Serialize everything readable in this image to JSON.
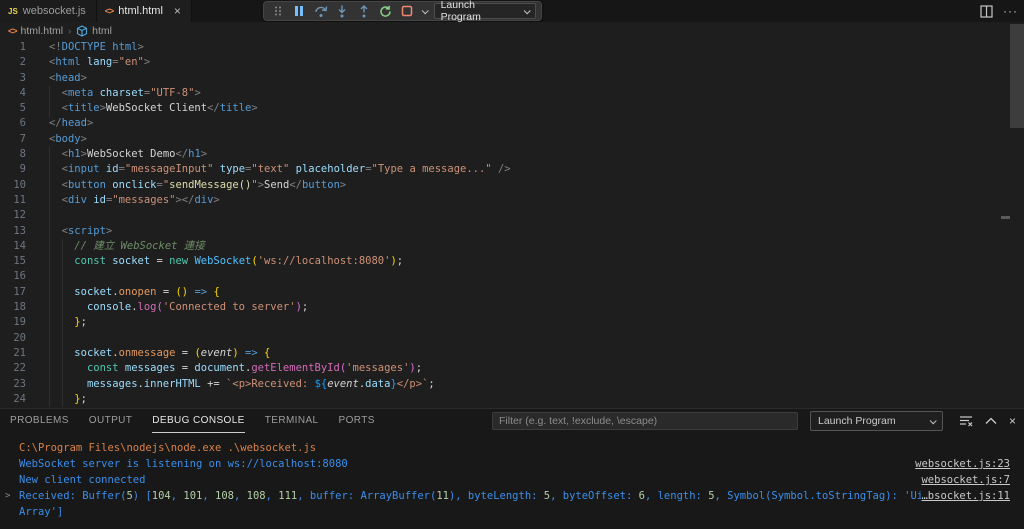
{
  "editor_tabs": [
    {
      "label": "websocket.js",
      "icon": "js-file-icon",
      "active": false
    },
    {
      "label": "html.html",
      "icon": "html-file-icon",
      "active": true,
      "close_glyph": "×"
    }
  ],
  "debug_toolbar": {
    "launch_label": "Launch Program",
    "icons": [
      "drag-grip",
      "pause",
      "step-over",
      "step-into",
      "step-out",
      "restart",
      "stop",
      "stop-dropdown-chevron"
    ]
  },
  "editor_actions": {
    "split_icon": "split-editor",
    "more_icon": "more-actions",
    "more_glyph": "···"
  },
  "breadcrumb": {
    "file": "html.html",
    "separator": "›",
    "symbol": "html"
  },
  "editor": {
    "lines": [
      {
        "n": 1,
        "s": [
          [
            "g",
            "<!"
          ],
          [
            "t",
            "DOCTYPE"
          ],
          [
            "w",
            " "
          ],
          [
            "t",
            "html"
          ],
          [
            "g",
            ">"
          ]
        ]
      },
      {
        "n": 2,
        "s": [
          [
            "g",
            "<"
          ],
          [
            "t",
            "html"
          ],
          [
            "w",
            " "
          ],
          [
            "a",
            "lang"
          ],
          [
            "g",
            "="
          ],
          [
            "s",
            "\"en\""
          ],
          [
            "g",
            ">"
          ]
        ]
      },
      {
        "n": 3,
        "s": [
          [
            "g",
            "<"
          ],
          [
            "t",
            "head"
          ],
          [
            "g",
            ">"
          ]
        ]
      },
      {
        "n": 4,
        "s": [
          [
            "w",
            "  "
          ],
          [
            "g",
            "<"
          ],
          [
            "t",
            "meta"
          ],
          [
            "w",
            " "
          ],
          [
            "a",
            "charset"
          ],
          [
            "g",
            "="
          ],
          [
            "s",
            "\"UTF-8\""
          ],
          [
            "g",
            ">"
          ]
        ]
      },
      {
        "n": 5,
        "s": [
          [
            "w",
            "  "
          ],
          [
            "g",
            "<"
          ],
          [
            "t",
            "title"
          ],
          [
            "g",
            ">"
          ],
          [
            "w",
            "WebSocket Client"
          ],
          [
            "g",
            "</"
          ],
          [
            "t",
            "title"
          ],
          [
            "g",
            ">"
          ]
        ]
      },
      {
        "n": 6,
        "s": [
          [
            "g",
            "</"
          ],
          [
            "t",
            "head"
          ],
          [
            "g",
            ">"
          ]
        ]
      },
      {
        "n": 7,
        "s": [
          [
            "g",
            "<"
          ],
          [
            "t",
            "body"
          ],
          [
            "g",
            ">"
          ]
        ]
      },
      {
        "n": 8,
        "s": [
          [
            "w",
            "  "
          ],
          [
            "g",
            "<"
          ],
          [
            "t",
            "h1"
          ],
          [
            "g",
            ">"
          ],
          [
            "w",
            "WebSocket Demo"
          ],
          [
            "g",
            "</"
          ],
          [
            "t",
            "h1"
          ],
          [
            "g",
            ">"
          ]
        ]
      },
      {
        "n": 9,
        "s": [
          [
            "w",
            "  "
          ],
          [
            "g",
            "<"
          ],
          [
            "t",
            "input"
          ],
          [
            "w",
            " "
          ],
          [
            "a",
            "id"
          ],
          [
            "g",
            "="
          ],
          [
            "s",
            "\"messageInput\""
          ],
          [
            "w",
            " "
          ],
          [
            "a",
            "type"
          ],
          [
            "g",
            "="
          ],
          [
            "s",
            "\"text\""
          ],
          [
            "w",
            " "
          ],
          [
            "a",
            "placeholder"
          ],
          [
            "g",
            "="
          ],
          [
            "s",
            "\"Type a message...\""
          ],
          [
            "w",
            " "
          ],
          [
            "g",
            "/>"
          ]
        ]
      },
      {
        "n": 10,
        "s": [
          [
            "w",
            "  "
          ],
          [
            "g",
            "<"
          ],
          [
            "t",
            "button"
          ],
          [
            "w",
            " "
          ],
          [
            "a",
            "onclick"
          ],
          [
            "g",
            "="
          ],
          [
            "s",
            "\""
          ],
          [
            "fy",
            "sendMessage()"
          ],
          [
            "s",
            "\""
          ],
          [
            "g",
            ">"
          ],
          [
            "w",
            "Send"
          ],
          [
            "g",
            "</"
          ],
          [
            "t",
            "button"
          ],
          [
            "g",
            ">"
          ]
        ]
      },
      {
        "n": 11,
        "s": [
          [
            "w",
            "  "
          ],
          [
            "g",
            "<"
          ],
          [
            "t",
            "div"
          ],
          [
            "w",
            " "
          ],
          [
            "a",
            "id"
          ],
          [
            "g",
            "="
          ],
          [
            "s",
            "\"messages\""
          ],
          [
            "g",
            "></"
          ],
          [
            "t",
            "div"
          ],
          [
            "g",
            ">"
          ]
        ]
      },
      {
        "n": 12,
        "s": []
      },
      {
        "n": 13,
        "s": [
          [
            "w",
            "  "
          ],
          [
            "g",
            "<"
          ],
          [
            "t",
            "script"
          ],
          [
            "g",
            ">"
          ]
        ]
      },
      {
        "n": 14,
        "s": [
          [
            "c",
            "    // 建立 WebSocket 連接"
          ]
        ]
      },
      {
        "n": 15,
        "s": [
          [
            "w",
            "    "
          ],
          [
            "k",
            "const"
          ],
          [
            "w",
            " "
          ],
          [
            "v",
            "socket"
          ],
          [
            "w",
            " = "
          ],
          [
            "k",
            "new"
          ],
          [
            "w",
            " "
          ],
          [
            "cl",
            "WebSocket"
          ],
          [
            "b1",
            "("
          ],
          [
            "s",
            "'ws://localhost:8080'"
          ],
          [
            "b1",
            ")"
          ],
          [
            "w",
            ";"
          ]
        ]
      },
      {
        "n": 16,
        "s": []
      },
      {
        "n": 17,
        "s": [
          [
            "w",
            "    "
          ],
          [
            "v",
            "socket"
          ],
          [
            "w",
            "."
          ],
          [
            "o",
            "onopen"
          ],
          [
            "w",
            " = "
          ],
          [
            "b1",
            "()"
          ],
          [
            "w",
            " "
          ],
          [
            "ar",
            "=>"
          ],
          [
            "w",
            " "
          ],
          [
            "b1",
            "{"
          ]
        ]
      },
      {
        "n": 18,
        "s": [
          [
            "w",
            "      "
          ],
          [
            "v",
            "console"
          ],
          [
            "w",
            "."
          ],
          [
            "fm",
            "log"
          ],
          [
            "b2",
            "("
          ],
          [
            "s",
            "'Connected to server'"
          ],
          [
            "b2",
            ")"
          ],
          [
            "w",
            ";"
          ]
        ]
      },
      {
        "n": 19,
        "s": [
          [
            "w",
            "    "
          ],
          [
            "b1",
            "}"
          ],
          [
            "w",
            ";"
          ]
        ]
      },
      {
        "n": 20,
        "s": []
      },
      {
        "n": 21,
        "s": [
          [
            "w",
            "    "
          ],
          [
            "v",
            "socket"
          ],
          [
            "w",
            "."
          ],
          [
            "o",
            "onmessage"
          ],
          [
            "w",
            " = "
          ],
          [
            "b1",
            "("
          ],
          [
            "it",
            "event"
          ],
          [
            "b1",
            ")"
          ],
          [
            "w",
            " "
          ],
          [
            "ar",
            "=>"
          ],
          [
            "w",
            " "
          ],
          [
            "b1",
            "{"
          ]
        ]
      },
      {
        "n": 22,
        "s": [
          [
            "w",
            "      "
          ],
          [
            "k",
            "const"
          ],
          [
            "w",
            " "
          ],
          [
            "v",
            "messages"
          ],
          [
            "w",
            " = "
          ],
          [
            "v",
            "document"
          ],
          [
            "w",
            "."
          ],
          [
            "fm",
            "getElementById"
          ],
          [
            "b2",
            "("
          ],
          [
            "s",
            "'messages'"
          ],
          [
            "b2",
            ")"
          ],
          [
            "w",
            ";"
          ]
        ]
      },
      {
        "n": 23,
        "s": [
          [
            "w",
            "      "
          ],
          [
            "v",
            "messages"
          ],
          [
            "w",
            "."
          ],
          [
            "v",
            "innerHTML"
          ],
          [
            "w",
            " += "
          ],
          [
            "s",
            "`<p>Received: "
          ],
          [
            "b3",
            "${"
          ],
          [
            "it",
            "event"
          ],
          [
            "w",
            "."
          ],
          [
            "v",
            "data"
          ],
          [
            "b3",
            "}"
          ],
          [
            "s",
            "</p>`"
          ],
          [
            "w",
            ";"
          ]
        ]
      },
      {
        "n": 24,
        "s": [
          [
            "w",
            "    "
          ],
          [
            "b1",
            "}"
          ],
          [
            "w",
            ";"
          ]
        ]
      }
    ]
  },
  "panel": {
    "tabs": [
      {
        "label": "PROBLEMS",
        "active": false
      },
      {
        "label": "OUTPUT",
        "active": false
      },
      {
        "label": "DEBUG CONSOLE",
        "active": true
      },
      {
        "label": "TERMINAL",
        "active": false
      },
      {
        "label": "PORTS",
        "active": false
      }
    ],
    "filter_placeholder": "Filter (e.g. text, !exclude, \\escape)",
    "launch_label": "Launch Program",
    "icons": [
      "clear-console",
      "maximize-panel",
      "close-panel"
    ],
    "console": [
      {
        "s": [
          [
            "co",
            "C:\\Program Files\\nodejs\\node.exe .\\websocket.js"
          ]
        ]
      },
      {
        "s": [
          [
            "cb",
            "WebSocket server is listening on ws://localhost:8080"
          ]
        ],
        "link": "websocket.js:23"
      },
      {
        "s": [
          [
            "cb",
            "New client connected"
          ]
        ],
        "link": "websocket.js:7"
      },
      {
        "expand": true,
        "s": [
          [
            "cb",
            "Received: Buffer("
          ],
          [
            "cg",
            "5"
          ],
          [
            "cb",
            ") ["
          ],
          [
            "cg",
            "104"
          ],
          [
            "cb",
            ", "
          ],
          [
            "cg",
            "101"
          ],
          [
            "cb",
            ", "
          ],
          [
            "cg",
            "108"
          ],
          [
            "cb",
            ", "
          ],
          [
            "cg",
            "108"
          ],
          [
            "cb",
            ", "
          ],
          [
            "cg",
            "111"
          ],
          [
            "cb",
            ", buffer: ArrayBuffer("
          ],
          [
            "cg",
            "11"
          ],
          [
            "cb",
            "), byteLength: "
          ],
          [
            "cg",
            "5"
          ],
          [
            "cb",
            ", byteOffset: "
          ],
          [
            "cg",
            "6"
          ],
          [
            "cb",
            ", length: "
          ],
          [
            "cg",
            "5"
          ],
          [
            "cb",
            ", Symbol(Symbol.toStringTag): 'Uint8 "
          ]
        ],
        "link": "…bsocket.js:11"
      },
      {
        "s": [
          [
            "cb",
            "Array']"
          ]
        ]
      }
    ]
  },
  "colors": {
    "editor_bg": "#1e1e1e",
    "panel_bg": "#181818",
    "tag_blue": "#569cd6",
    "string_orange": "#ce9178",
    "keyword_teal": "#4ec9b0",
    "variable_blue": "#9cdcfe",
    "console_stdout_blue": "#3b8eea",
    "console_cmd_orange": "#d7824a",
    "number_green": "#b5cea8",
    "pause_blue": "#75beff",
    "restart_green": "#89d185",
    "stop_red": "#f48771",
    "js_icon_yellow": "#e8d44d",
    "html_icon_orange": "#e8824a"
  }
}
